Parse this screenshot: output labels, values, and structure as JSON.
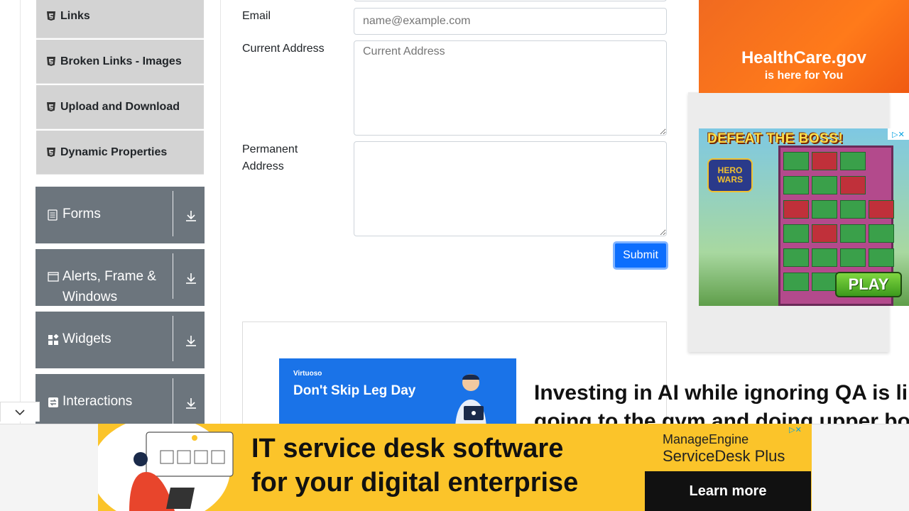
{
  "sidebar": {
    "sub_items": [
      {
        "label": "Links"
      },
      {
        "label": "Broken Links - Images"
      },
      {
        "label": "Upload and Download"
      },
      {
        "label": "Dynamic Properties"
      }
    ],
    "groups": [
      {
        "label": "Forms"
      },
      {
        "label": "Alerts, Frame & Windows"
      },
      {
        "label": "Widgets"
      },
      {
        "label": "Interactions"
      }
    ]
  },
  "form": {
    "email_label": "Email",
    "email_placeholder": "name@example.com",
    "current_address_label": "Current Address",
    "current_address_placeholder": "Current Address",
    "permanent_address_label": "Permanent Address",
    "permanent_address_value": "",
    "submit_label": "Submit"
  },
  "ads": {
    "healthcare_line1": "HealthCare.gov",
    "healthcare_line2": "is here for You",
    "game_title": "DEFEAT THE BOSS!",
    "game_logo": "HERO WARS",
    "game_play": "PLAY",
    "virtuoso_brand": "Virtuoso",
    "virtuoso_tagline": "Don't Skip Leg Day",
    "bottom_line1": "IT service desk software",
    "bottom_line2": "for your digital enterprise",
    "bottom_brand1": "ManageEngine",
    "bottom_brand2": "ServiceDesk Plus",
    "bottom_cta": "Learn more"
  },
  "headline": {
    "line1": "Investing in AI while ignoring QA is lik",
    "line2": "going to the gym and doing upper bo"
  },
  "colors": {
    "accent": "#0d6efd",
    "group_bg": "#6c757d",
    "sub_item_bg": "#d3d3d3"
  }
}
